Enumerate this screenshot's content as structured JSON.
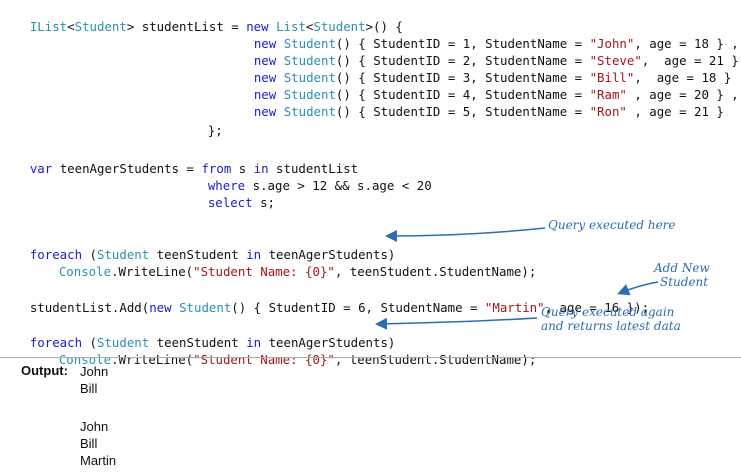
{
  "code": {
    "l1": {
      "a": "IList",
      "b": "<",
      "c": "Student",
      "d": "> studentList = ",
      "e": "new",
      "f": " ",
      "g": "List",
      "h": "<",
      "i": "Student",
      "j": ">() {"
    },
    "students": [
      {
        "kw": "new",
        "ty": "Student",
        "p1": "() { StudentID = 1, StudentName = ",
        "name": "\"John\"",
        "p2": ", age = 18 } ,"
      },
      {
        "kw": "new",
        "ty": "Student",
        "p1": "() { StudentID = 2, StudentName = ",
        "name": "\"Steve\"",
        "p2": ",  age = 21 } ,"
      },
      {
        "kw": "new",
        "ty": "Student",
        "p1": "() { StudentID = 3, StudentName = ",
        "name": "\"Bill\"",
        "p2": ",  age = 18 } ,"
      },
      {
        "kw": "new",
        "ty": "Student",
        "p1": "() { StudentID = 4, StudentName = ",
        "name": "\"Ram\"",
        "p2": " , age = 20 } ,"
      },
      {
        "kw": "new",
        "ty": "Student",
        "p1": "() { StudentID = 5, StudentName = ",
        "name": "\"Ron\"",
        "p2": " , age = 21 }"
      }
    ],
    "close": "};",
    "q1": {
      "kw": "var",
      "a": " teenAgerStudents = ",
      "kw2": "from",
      "b": " s ",
      "kw3": "in",
      "c": " studentList"
    },
    "q2": {
      "kw": "where",
      "a": " s.age > 12 && s.age < 20"
    },
    "q3": {
      "kw": "select",
      "a": " s;"
    },
    "f1": {
      "kw": "foreach",
      "a": " (",
      "ty": "Student",
      "b": " teenStudent ",
      "kw2": "in",
      "c": " teenAgerStudents)"
    },
    "f1b": {
      "ty": "Console",
      "a": ".WriteLine(",
      "st": "\"Student Name: {0}\"",
      "b": ", teenStudent.StudentName);"
    },
    "add": {
      "a": "studentList.Add(",
      "kw": "new",
      "b": " ",
      "ty": "Student",
      "c": "() { StudentID = 6, StudentName = ",
      "st": "\"Martin\"",
      "d": ", age = 16 });"
    },
    "f2": {
      "kw": "foreach",
      "a": " (",
      "ty": "Student",
      "b": " teenStudent ",
      "kw2": "in",
      "c": " teenAgerStudents)"
    },
    "f2b": {
      "ty": "Console",
      "a": ".WriteLine(",
      "st": "\"Student Name: {0}\"",
      "b": ", teenStudent.StudentName);"
    }
  },
  "annotations": {
    "query_executed": "Query executed here",
    "add_new_1": "Add New",
    "add_new_2": "Student",
    "again_1": "Query executed again",
    "again_2": "and returns latest data"
  },
  "output": {
    "label": "Output:",
    "lines": [
      "John",
      "Bill",
      "John",
      "Bill",
      "Martin"
    ]
  },
  "colors": {
    "keyword": "#1a1ad6",
    "type": "#2b91af",
    "string": "#a31515",
    "annotation": "#2e6bb0"
  }
}
